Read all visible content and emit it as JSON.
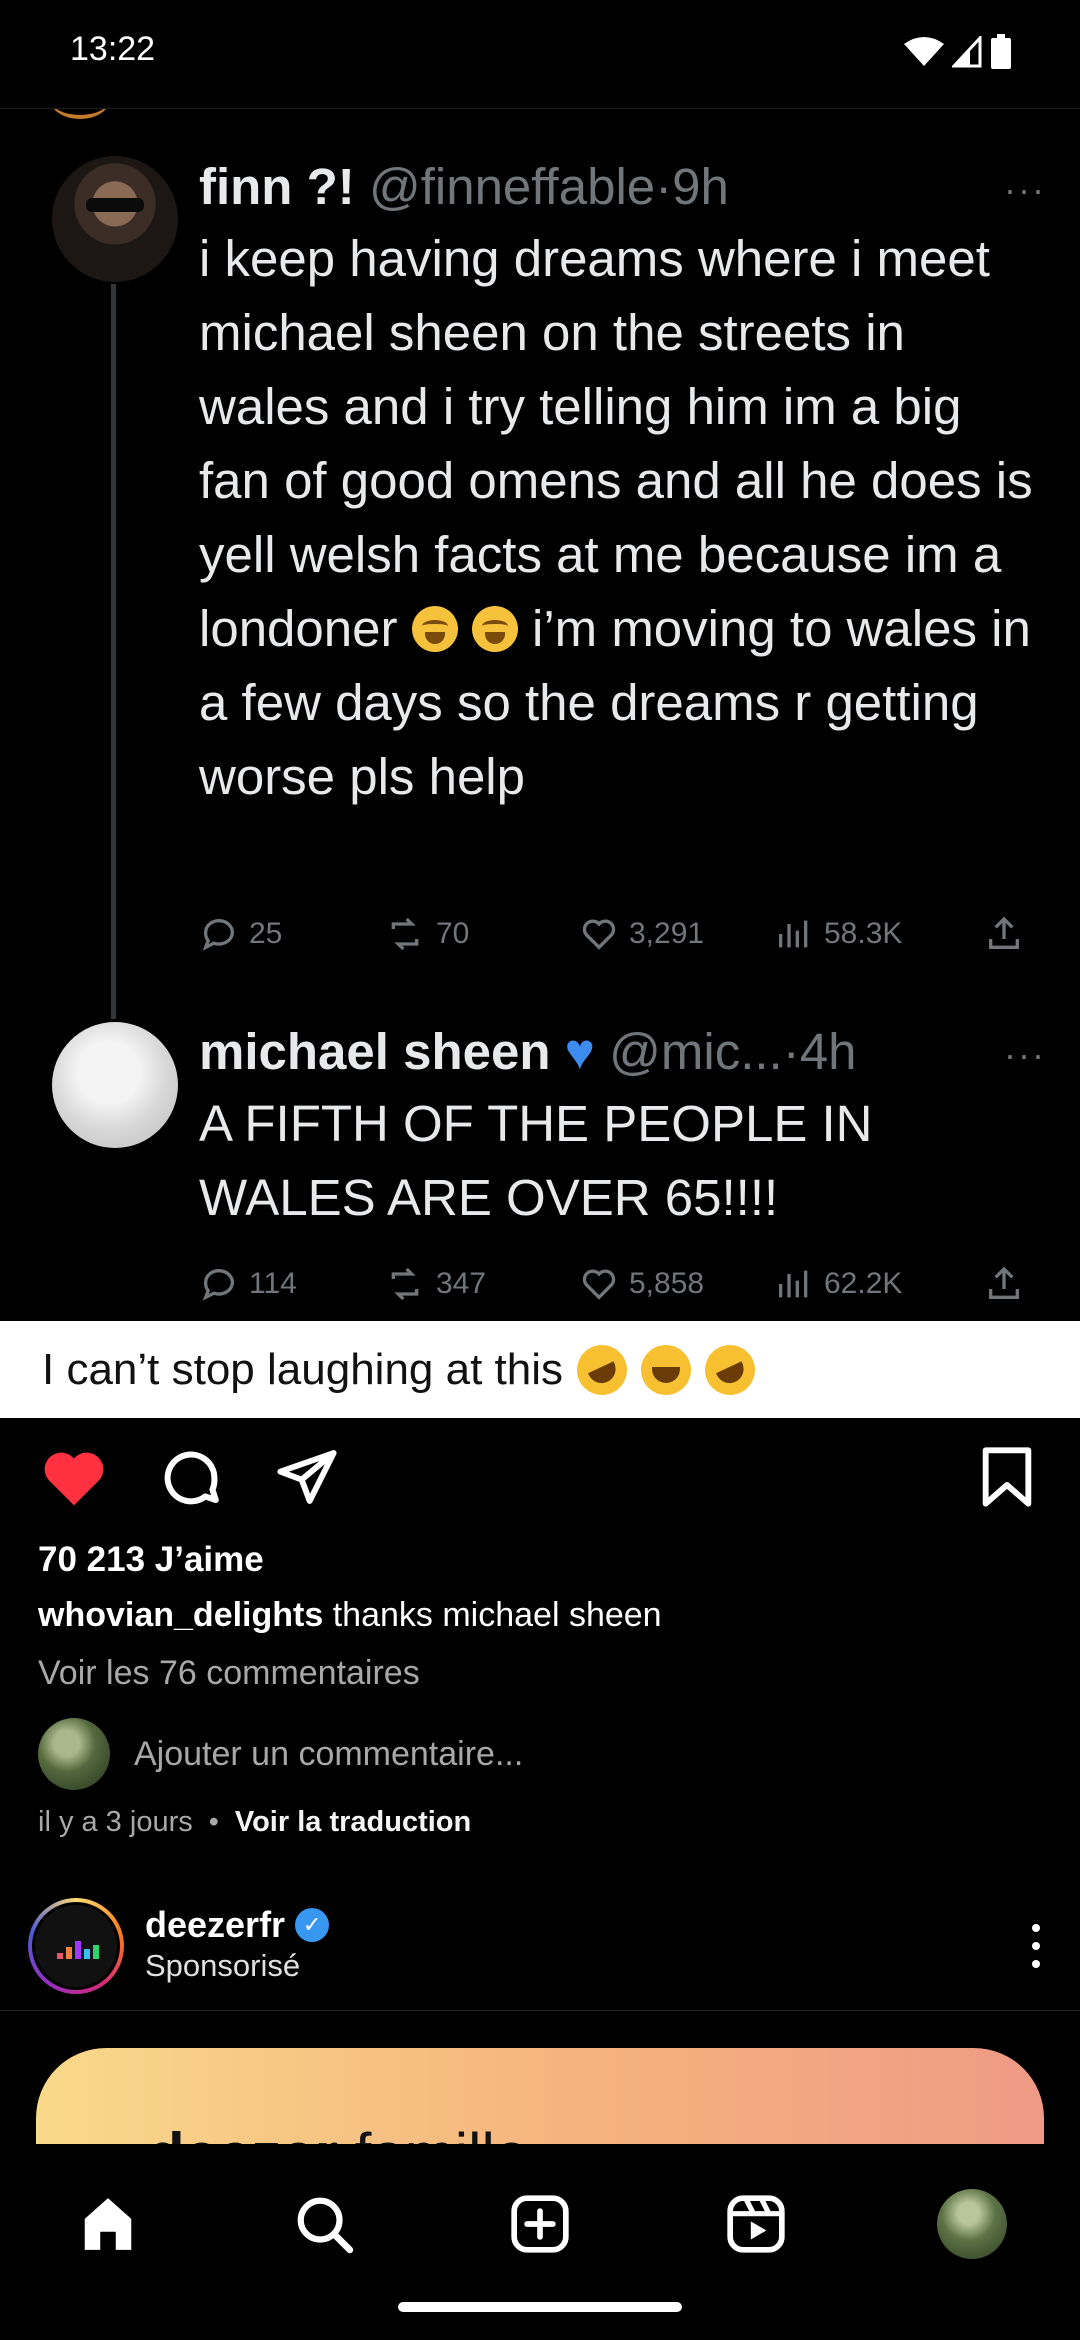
{
  "status_bar": {
    "time": "13:22"
  },
  "tweet_screenshot": {
    "tweets": [
      {
        "name": "finn ?!",
        "handle": "@finneffable",
        "time": "9h",
        "text_parts": [
          "i keep having dreams where i meet michael sheen on the streets in wales and i try telling him im a big fan of good omens and all he does is yell welsh facts at me because im a londoner ",
          " i’m moving to wales in a few days so the dreams r getting worse pls help"
        ],
        "stats": {
          "replies": "25",
          "retweets": "70",
          "likes": "3,291",
          "views": "58.3K"
        }
      },
      {
        "name": "michael sheen",
        "handle": "@mic...",
        "time": "4h",
        "text": "A FIFTH OF THE PEOPLE IN WALES ARE OVER 65!!!!",
        "stats": {
          "replies": "114",
          "retweets": "347",
          "likes": "5,858",
          "views": "62.2K"
        }
      }
    ],
    "separator": "·"
  },
  "image_caption": "I can’t stop laughing at this",
  "post": {
    "likes": "70 213 J’aime",
    "caption_user": "whovian_delights",
    "caption_text": "thanks michael sheen",
    "view_comments": "Voir les 76 commentaires",
    "add_comment_placeholder": "Ajouter un commentaire...",
    "time_ago": "il y a 3 jours",
    "dot": "•",
    "translate": "Voir la traduction"
  },
  "sponsored": {
    "account": "deezerfr",
    "label": "Sponsorisé",
    "ad_text_brand": ":deezer",
    "ad_text_rest": " famille"
  },
  "colors": {
    "like_red": "#ff3040",
    "verified_blue": "#3897f0",
    "heart_blue_emoji": "#3d8cf0"
  },
  "icons": [
    "heart-icon",
    "comment-icon",
    "share-icon",
    "bookmark-icon",
    "home-icon",
    "search-icon",
    "create-icon",
    "reels-icon"
  ]
}
